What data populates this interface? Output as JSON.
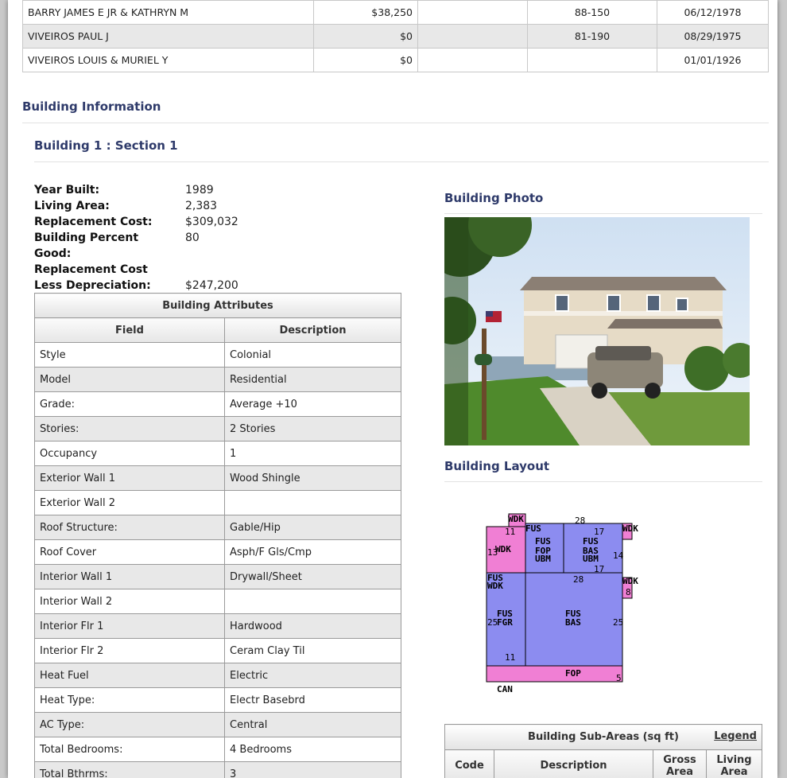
{
  "sales": [
    {
      "owner": "BARRY JAMES E JR & KATHRYN M",
      "price": "$38,250",
      "cert": "",
      "book_page": "88-150",
      "date": "06/12/1978"
    },
    {
      "owner": "VIVEIROS PAUL J",
      "price": "$0",
      "cert": "",
      "book_page": "81-190",
      "date": "08/29/1975"
    },
    {
      "owner": "VIVEIROS LOUIS & MURIEL Y",
      "price": "$0",
      "cert": "",
      "book_page": "",
      "date": "01/01/1926"
    }
  ],
  "building_info_title": "Building Information",
  "building_section_title": "Building 1 : Section 1",
  "info": [
    {
      "label": "Year Built:",
      "value": "1989"
    },
    {
      "label": "Living Area:",
      "value": "2,383"
    },
    {
      "label": "Replacement Cost:",
      "value": "$309,032"
    },
    {
      "label": "Building Percent Good:",
      "value": "80"
    },
    {
      "label": "Replacement Cost Less Depreciation:",
      "value": "$247,200"
    }
  ],
  "attributes": {
    "caption": "Building Attributes",
    "col_field": "Field",
    "col_desc": "Description",
    "rows": [
      {
        "field": "Style",
        "desc": "Colonial"
      },
      {
        "field": "Model",
        "desc": "Residential"
      },
      {
        "field": "Grade:",
        "desc": "Average +10"
      },
      {
        "field": "Stories:",
        "desc": "2 Stories"
      },
      {
        "field": "Occupancy",
        "desc": "1"
      },
      {
        "field": "Exterior Wall 1",
        "desc": "Wood Shingle"
      },
      {
        "field": "Exterior Wall 2",
        "desc": ""
      },
      {
        "field": "Roof Structure:",
        "desc": "Gable/Hip"
      },
      {
        "field": "Roof Cover",
        "desc": "Asph/F Gls/Cmp"
      },
      {
        "field": "Interior Wall 1",
        "desc": "Drywall/Sheet"
      },
      {
        "field": "Interior Wall 2",
        "desc": ""
      },
      {
        "field": "Interior Flr 1",
        "desc": "Hardwood"
      },
      {
        "field": "Interior Flr 2",
        "desc": "Ceram Clay Til"
      },
      {
        "field": "Heat Fuel",
        "desc": "Electric"
      },
      {
        "field": "Heat Type:",
        "desc": "Electr Basebrd"
      },
      {
        "field": "AC Type:",
        "desc": "Central"
      },
      {
        "field": "Total Bedrooms:",
        "desc": "4 Bedrooms"
      },
      {
        "field": "Total Bthrms:",
        "desc": "3"
      }
    ]
  },
  "photo_title": "Building Photo",
  "layout_title": "Building Layout",
  "sketch": {
    "labels": [
      "WDK",
      "FUS",
      "FOP",
      "UBM",
      "BAS",
      "FGR",
      "CAN",
      "FOP"
    ],
    "dims": [
      "28",
      "17",
      "11",
      "13",
      "14",
      "25",
      "5",
      "8"
    ]
  },
  "subareas": {
    "caption": "Building Sub-Areas (sq ft)",
    "legend": "Legend",
    "col_code": "Code",
    "col_desc": "Description",
    "col_gross": "Gross Area",
    "col_living": "Living Area"
  },
  "colors": {
    "heading": "#2e3a6a",
    "sketch_blue": "#8c8cf0",
    "sketch_pink": "#f07fd4"
  }
}
